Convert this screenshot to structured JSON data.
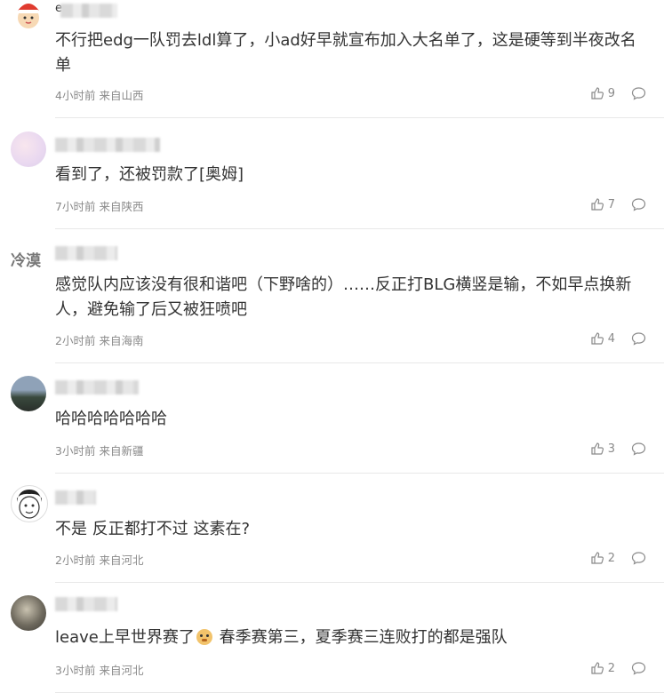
{
  "comments": [
    {
      "avatar_type": "image",
      "avatar_desc": "cartoon-kid-avatar",
      "name_initial": "e",
      "content": "不行把edg一队罚去ldl算了，小ad好早就宣布加入大名单了，这是硬等到半夜改名单",
      "time": "4小时前",
      "location": "来自山西",
      "likes": "9"
    },
    {
      "avatar_type": "image",
      "avatar_desc": "pastel-avatar",
      "name_initial": "",
      "content": "看到了，还被罚款了[奥姆]",
      "time": "7小时前",
      "location": "来自陕西",
      "likes": "7"
    },
    {
      "avatar_type": "text",
      "avatar_text": "冷漠",
      "name_initial": "",
      "content": "感觉队内应该没有很和谐吧（下野啥的）……反正打BLG横竖是输，不如早点换新人，避免输了后又被狂喷吧",
      "time": "2小时前",
      "location": "来自海南",
      "likes": "4"
    },
    {
      "avatar_type": "image",
      "avatar_desc": "landscape-avatar",
      "name_initial": "",
      "content": "哈哈哈哈哈哈哈",
      "time": "3小时前",
      "location": "来自新疆",
      "likes": "3"
    },
    {
      "avatar_type": "image",
      "avatar_desc": "sketch-face-avatar",
      "name_initial": "",
      "content": "不是 反正都打不过 这素在?",
      "time": "2小时前",
      "location": "来自河北",
      "likes": "2"
    },
    {
      "avatar_type": "image",
      "avatar_desc": "photo-avatar",
      "name_initial": "",
      "content_before_emoji": "leave上早世界赛了",
      "content_after_emoji": " 春季赛第三，夏季赛三连败打的都是强队",
      "time": "3小时前",
      "location": "来自河北",
      "likes": "2"
    }
  ],
  "icons": {
    "like": "thumbs-up-icon",
    "reply": "comment-bubble-icon"
  }
}
